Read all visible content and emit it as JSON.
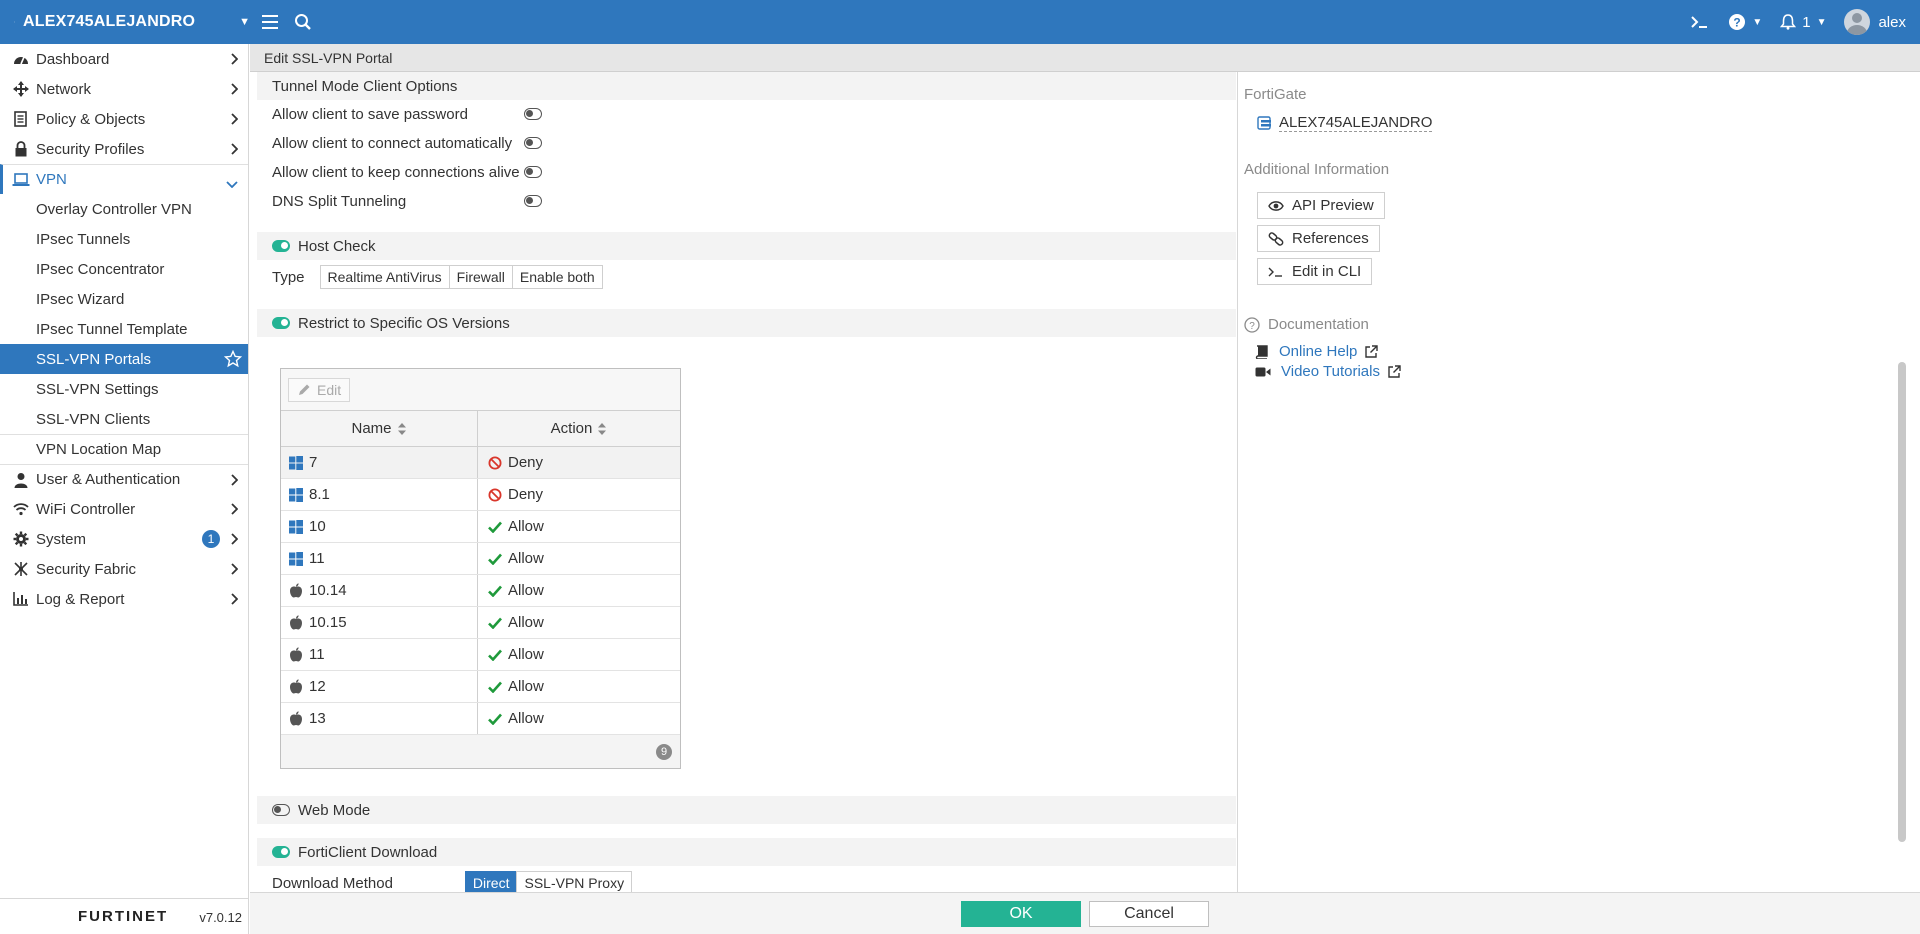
{
  "topbar": {
    "device_name": "ALEX745ALEJANDRO",
    "alerts_count": "1",
    "user": "alex"
  },
  "sidebar": {
    "items": [
      {
        "label": "Dashboard",
        "icon": "dashboard-icon"
      },
      {
        "label": "Network",
        "icon": "network-icon"
      },
      {
        "label": "Policy & Objects",
        "icon": "policy-icon"
      },
      {
        "label": "Security Profiles",
        "icon": "lock-icon"
      },
      {
        "label": "VPN",
        "icon": "laptop-icon"
      }
    ],
    "vpn_sub": [
      "Overlay Controller VPN",
      "IPsec Tunnels",
      "IPsec Concentrator",
      "IPsec Wizard",
      "IPsec Tunnel Template",
      "SSL-VPN Portals",
      "SSL-VPN Settings",
      "SSL-VPN Clients",
      "VPN Location Map"
    ],
    "items_after": [
      {
        "label": "User & Authentication",
        "icon": "user-icon"
      },
      {
        "label": "WiFi Controller",
        "icon": "wifi-icon"
      },
      {
        "label": "System",
        "icon": "gear-icon",
        "badge": "1"
      },
      {
        "label": "Security Fabric",
        "icon": "fabric-icon"
      },
      {
        "label": "Log & Report",
        "icon": "chart-icon"
      }
    ],
    "logo": "FURTINET",
    "version": "v7.0.12"
  },
  "page": {
    "title": "Edit SSL-VPN Portal"
  },
  "tunnel": {
    "heading": "Tunnel Mode Client Options",
    "options": [
      "Allow client to save password",
      "Allow client to connect automatically",
      "Allow client to keep connections alive",
      "DNS Split Tunneling"
    ]
  },
  "host_check": {
    "heading": "Host Check",
    "type_label": "Type",
    "types": [
      "Realtime AntiVirus",
      "Firewall",
      "Enable both"
    ]
  },
  "os_restrict": {
    "heading": "Restrict to Specific OS Versions",
    "edit_label": "Edit",
    "col_name": "Name",
    "col_action": "Action",
    "rows": [
      {
        "name": "7",
        "os": "windows",
        "action": "Deny"
      },
      {
        "name": "8.1",
        "os": "windows",
        "action": "Deny"
      },
      {
        "name": "10",
        "os": "windows",
        "action": "Allow"
      },
      {
        "name": "11",
        "os": "windows",
        "action": "Allow"
      },
      {
        "name": "10.14",
        "os": "apple",
        "action": "Allow"
      },
      {
        "name": "10.15",
        "os": "apple",
        "action": "Allow"
      },
      {
        "name": "11",
        "os": "apple",
        "action": "Allow"
      },
      {
        "name": "12",
        "os": "apple",
        "action": "Allow"
      },
      {
        "name": "13",
        "os": "apple",
        "action": "Allow"
      }
    ],
    "count": "9"
  },
  "web_mode": {
    "heading": "Web Mode"
  },
  "forticlient": {
    "heading": "FortiClient Download",
    "method_label": "Download Method",
    "methods": [
      "Direct",
      "SSL-VPN Proxy"
    ]
  },
  "right_panel": {
    "fortigate_label": "FortiGate",
    "device": "ALEX745ALEJANDRO",
    "additional_label": "Additional Information",
    "api_preview": "API Preview",
    "references": "References",
    "edit_cli": "Edit in CLI",
    "documentation": "Documentation",
    "online_help": "Online Help",
    "video_tutorials": "Video Tutorials"
  },
  "footer": {
    "ok": "OK",
    "cancel": "Cancel"
  },
  "colors": {
    "primary": "#2f77bd",
    "success": "#24b394",
    "deny": "#d9362b",
    "allow": "#1f9a3b"
  }
}
